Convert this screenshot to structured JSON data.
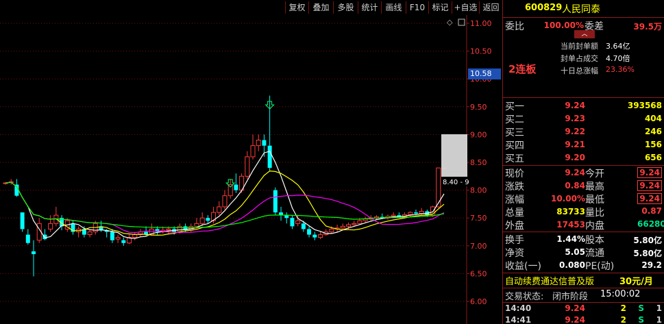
{
  "toolbar": {
    "items": [
      "复权",
      "叠加",
      "多股",
      "统计",
      "画线",
      "F10",
      "标记",
      "+自选",
      "返回"
    ]
  },
  "chart": {
    "y_ticks": [
      "11.00",
      "10.50",
      "10.00",
      "9.50",
      "9.00",
      "8.50",
      "8.00",
      "7.50",
      "7.00",
      "6.50",
      "6.00"
    ],
    "current_price_tag": "10.58",
    "hover_label": "8.40 - 9",
    "diamond": "◇"
  },
  "quote": {
    "code": "600829",
    "name": "人民同泰",
    "weibi_label": "委比",
    "weibi_value": "100.00%",
    "weicha_label": "委差",
    "weicha_value": "39.5万",
    "seal_amount_label": "当前封单额",
    "seal_amount_value": "3.64亿",
    "seal_ratio_label": "封单占成交",
    "seal_ratio_value": "4.70倍",
    "ten_day_label": "十日总涨幅",
    "ten_day_value": "23.36%",
    "board": "2连板",
    "bids": [
      {
        "label": "买一",
        "price": "9.24",
        "vol": "393568"
      },
      {
        "label": "买二",
        "price": "9.23",
        "vol": "404"
      },
      {
        "label": "买三",
        "price": "9.22",
        "vol": "246"
      },
      {
        "label": "买四",
        "price": "9.21",
        "vol": "156"
      },
      {
        "label": "买五",
        "price": "9.20",
        "vol": "656"
      }
    ],
    "stats": [
      {
        "l1": "现价",
        "v1": "9.24",
        "l2": "今开",
        "v2": "9.24"
      },
      {
        "l1": "涨跌",
        "v1": "0.84",
        "l2": "最高",
        "v2": "9.24"
      },
      {
        "l1": "涨幅",
        "v1": "10.00%",
        "l2": "最低",
        "v2": "9.24"
      },
      {
        "l1": "总量",
        "v1": "83733",
        "l2": "量比",
        "v2": "0.87"
      },
      {
        "l1": "外盘",
        "v1": "17453",
        "l2": "内盘",
        "v2": "66280"
      }
    ],
    "fund": [
      {
        "l1": "换手",
        "v1": "1.44%",
        "l2": "股本",
        "v2": "5.80亿"
      },
      {
        "l1": "净资",
        "v1": "5.05",
        "l2": "流通",
        "v2": "5.80亿"
      },
      {
        "l1": "收益(一)",
        "v1": "0.080",
        "l2": "PE(动)",
        "v2": "29.2"
      }
    ],
    "ad_text": "自动续费通达信普及版",
    "ad_price": "30元/月",
    "status_label": "交易状态:",
    "status_value": "闭市阶段",
    "status_time": "15:00:02",
    "ticks": [
      {
        "time": "14:40",
        "price": "9.24",
        "vol": "2",
        "side": "S",
        "n": "1"
      },
      {
        "time": "14:41",
        "price": "9.24",
        "vol": "2",
        "side": "S",
        "n": "1"
      }
    ]
  },
  "colors": {
    "up": "#ff3c3c",
    "down": "#00ffff",
    "ma5": "#ffffff",
    "ma10": "#ffff00",
    "ma20": "#ff00ff",
    "ma60": "#00ff00"
  }
}
